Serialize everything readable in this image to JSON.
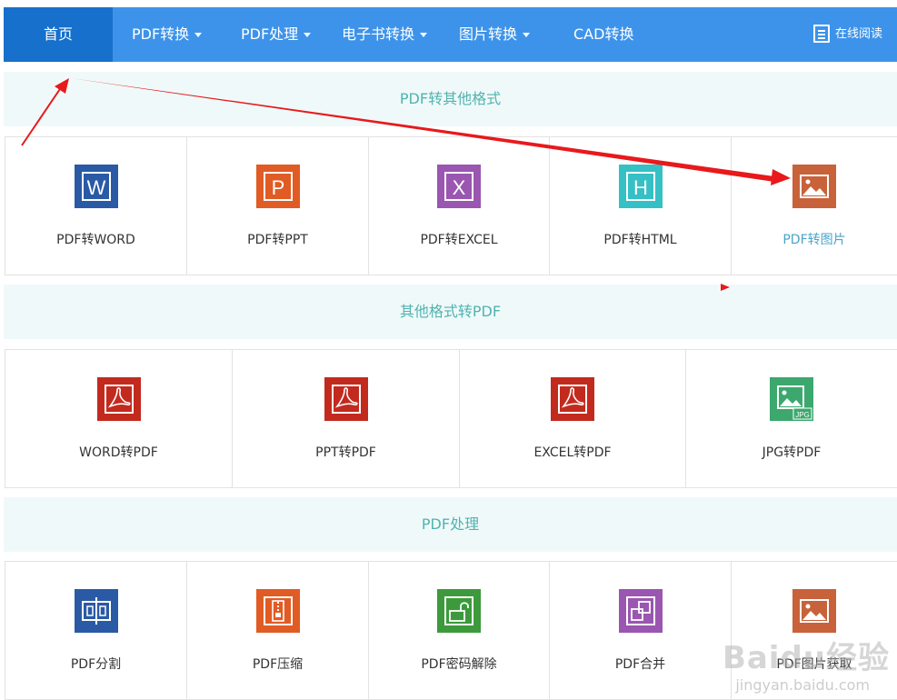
{
  "nav": {
    "home": "首页",
    "items": [
      "PDF转换",
      "PDF处理",
      "电子书转换",
      "图片转换",
      "CAD转换"
    ],
    "read": "在线阅读"
  },
  "sections": [
    {
      "title": "PDF转其他格式",
      "tiles": [
        {
          "label": "PDF转WORD",
          "icon": "word-icon",
          "color": "#2a5aa5"
        },
        {
          "label": "PDF转PPT",
          "icon": "ppt-icon",
          "color": "#e15b24"
        },
        {
          "label": "PDF转EXCEL",
          "icon": "excel-icon",
          "color": "#9a56b0"
        },
        {
          "label": "PDF转HTML",
          "icon": "html-icon",
          "color": "#35c0c6"
        },
        {
          "label": "PDF转图片",
          "icon": "image-icon",
          "color": "#c8623a"
        }
      ]
    },
    {
      "title": "其他格式转PDF",
      "tiles": [
        {
          "label": "WORD转PDF",
          "icon": "pdf-icon",
          "color": "#c32a1e"
        },
        {
          "label": "PPT转PDF",
          "icon": "pdf-icon",
          "color": "#c32a1e"
        },
        {
          "label": "EXCEL转PDF",
          "icon": "pdf-icon",
          "color": "#c32a1e"
        },
        {
          "label": "JPG转PDF",
          "icon": "jpg-icon",
          "color": "#3ca86e"
        }
      ]
    },
    {
      "title": "PDF处理",
      "tiles": [
        {
          "label": "PDF分割",
          "icon": "split-icon",
          "color": "#2a5aa5"
        },
        {
          "label": "PDF压缩",
          "icon": "compress-icon",
          "color": "#e15b24"
        },
        {
          "label": "PDF密码解除",
          "icon": "unlock-icon",
          "color": "#3c9a3c"
        },
        {
          "label": "PDF合并",
          "icon": "merge-icon",
          "color": "#9a56b0"
        },
        {
          "label": "PDF图片获取",
          "icon": "image-icon",
          "color": "#c8623a"
        }
      ]
    }
  ],
  "watermark": {
    "brand": "Baidu经验",
    "site": "jingyan.baidu.com"
  },
  "colors": {
    "nav": "#3d93ea",
    "nav_active": "#1670cc",
    "section_text": "#50b4b0",
    "arrow": "#e8191b"
  }
}
